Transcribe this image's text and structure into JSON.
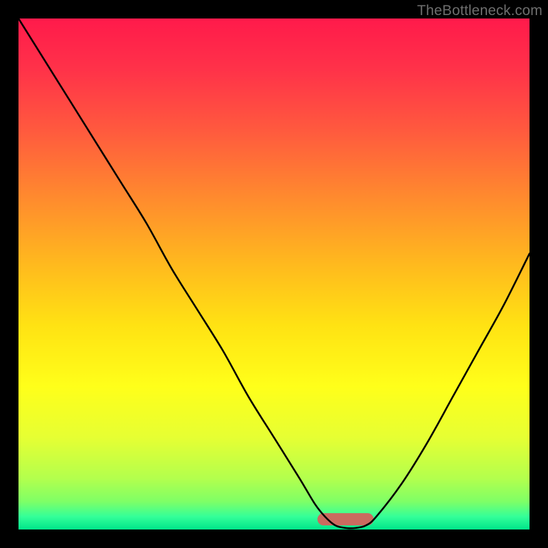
{
  "watermark": "TheBottleneck.com",
  "colors": {
    "frame": "#000000",
    "curve_stroke": "#000000",
    "bump_fill": "#cb6a5f",
    "gradient_stops": [
      {
        "offset": 0.0,
        "color": "#ff1a4b"
      },
      {
        "offset": 0.1,
        "color": "#ff3249"
      },
      {
        "offset": 0.22,
        "color": "#ff5a3e"
      },
      {
        "offset": 0.35,
        "color": "#ff8a2e"
      },
      {
        "offset": 0.48,
        "color": "#ffb91e"
      },
      {
        "offset": 0.6,
        "color": "#ffe213"
      },
      {
        "offset": 0.72,
        "color": "#ffff1a"
      },
      {
        "offset": 0.82,
        "color": "#e6ff33"
      },
      {
        "offset": 0.9,
        "color": "#b3ff4d"
      },
      {
        "offset": 0.945,
        "color": "#7fff66"
      },
      {
        "offset": 0.975,
        "color": "#33ff99"
      },
      {
        "offset": 1.0,
        "color": "#00e58a"
      }
    ]
  },
  "chart_data": {
    "type": "line",
    "title": "",
    "xlabel": "",
    "ylabel": "",
    "xlim": [
      0,
      100
    ],
    "ylim": [
      0,
      100
    ],
    "grid": false,
    "series": [
      {
        "name": "bottleneck-curve",
        "x": [
          0,
          5,
          10,
          15,
          20,
          25,
          30,
          35,
          40,
          45,
          50,
          55,
          58,
          60,
          62,
          64,
          66,
          68,
          70,
          75,
          80,
          85,
          90,
          95,
          100
        ],
        "y": [
          100,
          92,
          84,
          76,
          68,
          60,
          51,
          43,
          35,
          26,
          18,
          10,
          5,
          2.5,
          0.8,
          0.3,
          0.3,
          0.8,
          2.5,
          9,
          17,
          26,
          35,
          44,
          54
        ]
      }
    ],
    "annotations": [
      {
        "name": "target-bump",
        "x_range": [
          58.5,
          69.5
        ],
        "y": 0.8,
        "height": 2.4
      }
    ]
  }
}
